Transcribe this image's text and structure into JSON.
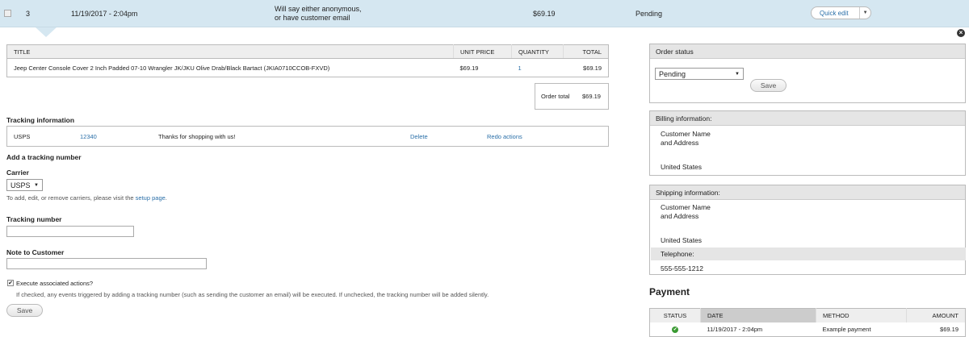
{
  "order_row": {
    "number": "3",
    "date": "11/19/2017 - 2:04pm",
    "customer_line1": "Will say either anonymous,",
    "customer_line2": "or have customer email",
    "total": "$69.19",
    "status": "Pending",
    "quick_edit": "Quick edit"
  },
  "items_table": {
    "headers": [
      "TITLE",
      "UNIT PRICE",
      "QUANTITY",
      "TOTAL"
    ],
    "rows": [
      [
        "Jeep Center Console Cover 2 Inch Padded 07-10 Wrangler JK/JKU Olive Drab/Black Bartact (JKIA0710CCOB-FXVD)",
        "$69.19",
        "1",
        "$69.19"
      ]
    ],
    "order_total_label": "Order total",
    "order_total_value": "$69.19"
  },
  "tracking": {
    "heading": "Tracking information",
    "carrier": "USPS",
    "number": "12340",
    "message": "Thanks for shopping with us!",
    "delete": "Delete",
    "redo": "Redo actions"
  },
  "add_tracking": {
    "heading": "Add a tracking number",
    "carrier_label": "Carrier",
    "carrier_value": "USPS",
    "help_prefix": "To add, edit, or remove carriers, please visit the",
    "help_link": "setup page",
    "tracking_label": "Tracking number",
    "note_label": "Note to Customer",
    "execute_label": "Execute associated actions?",
    "execute_help": "If checked, any events triggered by adding a tracking number (such as sending the customer an email) will be executed. If unchecked, the tracking number will be added silently.",
    "save": "Save"
  },
  "order_status": {
    "heading": "Order status",
    "value": "Pending",
    "save": "Save"
  },
  "billing": {
    "heading": "Billing information:",
    "line1": "Customer Name",
    "line2": "and Address",
    "country": "United States"
  },
  "shipping": {
    "heading": "Shipping information:",
    "line1": "Customer Name",
    "line2": "and Address",
    "country": "United States",
    "telephone_label": "Telephone:",
    "telephone": "555-555-1212"
  },
  "payment": {
    "heading": "Payment",
    "headers": [
      "STATUS",
      "DATE",
      "METHOD",
      "AMOUNT"
    ],
    "row": {
      "date": "11/19/2017 - 2:04pm",
      "method": "Example payment",
      "amount": "$69.19"
    }
  },
  "colors": {
    "header_bg": "#d5e7f1",
    "link": "#2a6fa8",
    "ok": "#3a9a32"
  }
}
